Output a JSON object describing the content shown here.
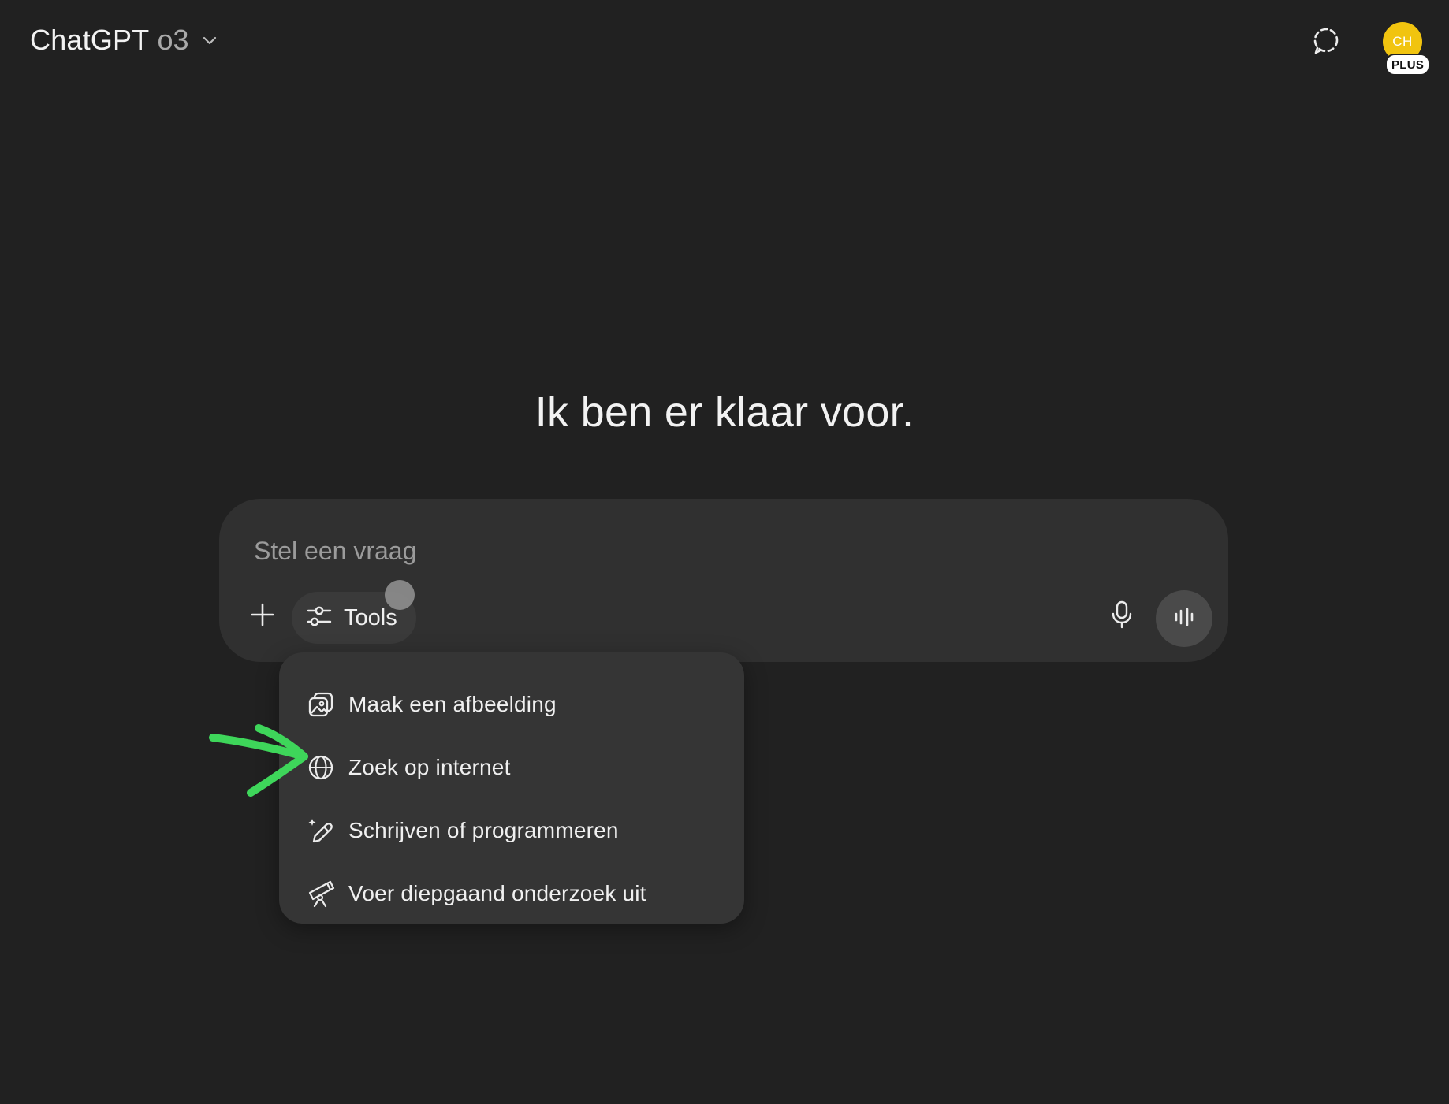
{
  "header": {
    "app_name": "ChatGPT",
    "model_name": "o3",
    "model_chevron_icon": "chevron-down-icon",
    "temp_chat_icon": "dashed-chat-bubble-icon",
    "avatar_initials": "CH",
    "plan_badge": "PLUS",
    "avatar_color": "#f1c40f"
  },
  "main": {
    "greeting": "Ik ben er klaar voor."
  },
  "composer": {
    "placeholder": "Stel een vraag",
    "value": "",
    "add_icon": "plus-icon",
    "tools_label": "Tools",
    "tools_icon": "sliders-icon",
    "mic_icon": "microphone-icon",
    "voice_icon": "voice-waveform-icon"
  },
  "tools_menu": {
    "items": [
      {
        "label": "Maak een afbeelding",
        "icon": "image-icon"
      },
      {
        "label": "Zoek op internet",
        "icon": "globe-icon"
      },
      {
        "label": "Schrijven of programmeren",
        "icon": "pen-sparkle-icon"
      },
      {
        "label": "Voer diepgaand onderzoek uit",
        "icon": "telescope-icon"
      }
    ]
  },
  "annotation": {
    "arrow_color": "#3ed65a",
    "points_to": "Zoek op internet"
  }
}
